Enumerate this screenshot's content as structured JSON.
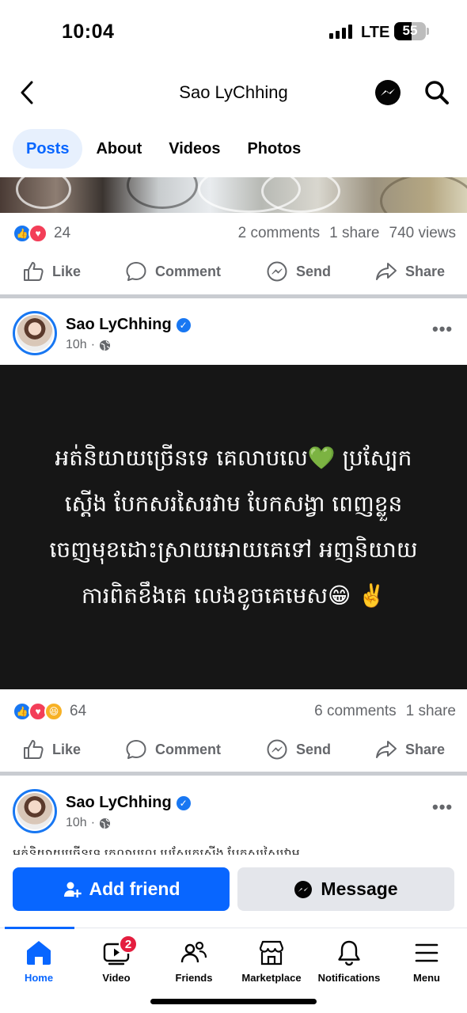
{
  "status_bar": {
    "time": "10:04",
    "network": "LTE",
    "battery": "55"
  },
  "header": {
    "title": "Sao LyChhing"
  },
  "tabs": [
    {
      "label": "Posts",
      "active": true
    },
    {
      "label": "About"
    },
    {
      "label": "Videos"
    },
    {
      "label": "Photos"
    }
  ],
  "post1": {
    "reaction_count": "24",
    "comments": "2 comments",
    "shares": "1 share",
    "views": "740 views"
  },
  "actions": {
    "like": "Like",
    "comment": "Comment",
    "send": "Send",
    "share": "Share"
  },
  "post2": {
    "author": "Sao LyChhing",
    "time": "10h",
    "lines": [
      "អត់និយាយច្រើនទេ គេលាបលេ💚 ប្រស្បែក",
      "ស្តើង បែកសរសៃរវាម បែកសង្វា ពេញខ្លួន",
      "ចេញមុខដោះស្រាយអោយគេទៅ អញនិយាយ",
      "ការពិតខឹងគេ លេងខូចគេមេស😁 ✌️"
    ],
    "reaction_count": "64",
    "comments": "6 comments",
    "shares": "1 share"
  },
  "post3": {
    "author": "Sao LyChhing",
    "time": "10h",
    "preview_text": "អត់និយាយច្រើនទេ គេលាបលេ ប្រស្បែកស្តើង បែកសរសៃរវាម"
  },
  "buttons": {
    "add_friend": "Add friend",
    "message": "Message"
  },
  "bottom_nav": {
    "home": "Home",
    "video": "Video",
    "video_badge": "2",
    "friends": "Friends",
    "marketplace": "Marketplace",
    "notifications": "Notifications",
    "menu": "Menu"
  },
  "colors": {
    "accent": "#0866ff",
    "badge": "#e41e3f",
    "post_bg": "#161616"
  }
}
